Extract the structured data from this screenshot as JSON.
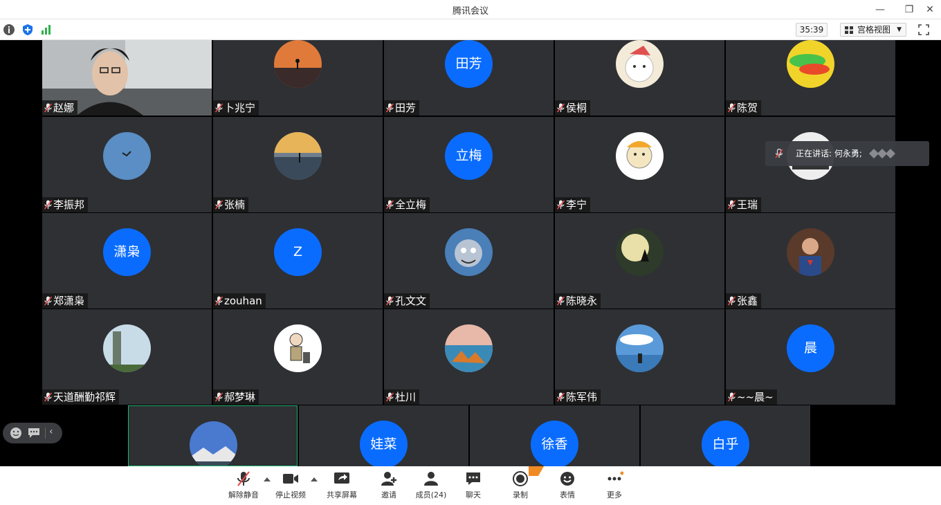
{
  "app": {
    "title": "腾讯会议"
  },
  "toolbar": {
    "timer": "35:39",
    "view_label": "宫格视图"
  },
  "speaking": {
    "label": "正在讲话: 何永勇;"
  },
  "tiles": [
    {
      "name": "赵娜",
      "avatar": "video"
    },
    {
      "name": "卜兆宁",
      "avatar": "sunset-person"
    },
    {
      "name": "田芳",
      "avatar": "text",
      "avatar_text": "田芳"
    },
    {
      "name": "侯桐",
      "avatar": "cartoon-cat"
    },
    {
      "name": "陈贺",
      "avatar": "abstract-color"
    },
    {
      "name": "李振邦",
      "avatar": "sky-bird"
    },
    {
      "name": "张楠",
      "avatar": "beach-sunset"
    },
    {
      "name": "全立梅",
      "avatar": "text",
      "avatar_text": "立梅"
    },
    {
      "name": "李宁",
      "avatar": "meme-face"
    },
    {
      "name": "王瑞",
      "avatar": "champions"
    },
    {
      "name": "郑潇枭",
      "avatar": "text",
      "avatar_text": "潇枭"
    },
    {
      "name": "zouhan",
      "avatar": "text",
      "avatar_text": "Z"
    },
    {
      "name": "孔文文",
      "avatar": "tom-cat"
    },
    {
      "name": "陈晓永",
      "avatar": "wolf-moon"
    },
    {
      "name": "张鑫",
      "avatar": "superman"
    },
    {
      "name": "天道酬勤祁辉",
      "avatar": "tower"
    },
    {
      "name": "郝梦琳",
      "avatar": "cartoon-girl"
    },
    {
      "name": "杜川",
      "avatar": "sea-rocks"
    },
    {
      "name": "陈军伟",
      "avatar": "lake-person"
    },
    {
      "name": "~~晨~",
      "avatar": "text",
      "avatar_text": "晨"
    },
    {
      "name": "",
      "avatar": "mountain-sky"
    },
    {
      "name": "",
      "avatar": "text",
      "avatar_text": "娃菜"
    },
    {
      "name": "",
      "avatar": "text",
      "avatar_text": "徐香"
    },
    {
      "name": "",
      "avatar": "text",
      "avatar_text": "白乎"
    }
  ],
  "bottombar": {
    "unmute": "解除静音",
    "stop_video": "停止视频",
    "share_screen": "共享屏幕",
    "invite": "邀请",
    "members": "成员(24)",
    "chat": "聊天",
    "record": "录制",
    "reactions": "表情",
    "more": "更多"
  },
  "colors": {
    "accent": "#0a6cff",
    "tile_bg": "#2e3034",
    "active_border": "#1bb36b"
  }
}
